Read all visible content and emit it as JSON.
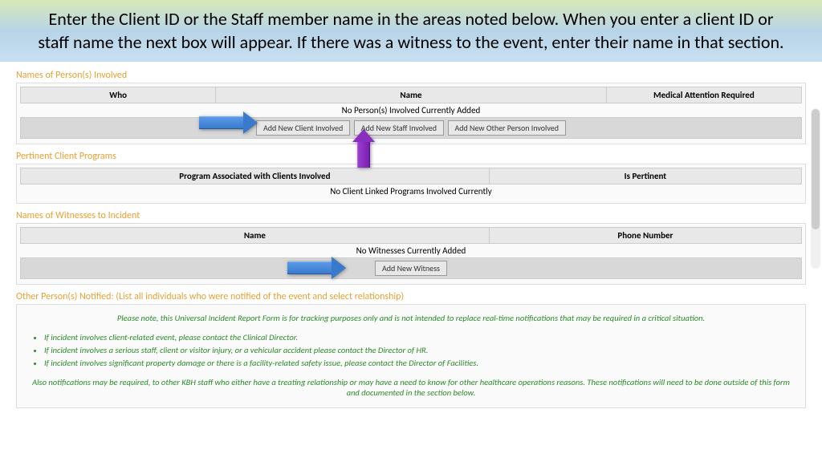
{
  "banner": {
    "text": "Enter the Client ID or the Staff member name in the areas noted below. When you enter a client ID or staff name the next box will appear. If there was a witness to the event, enter their name in that section."
  },
  "sections": {
    "persons": {
      "title": "Names of Person(s) Involved",
      "headers": [
        "Who",
        "Name",
        "Medical Attention Required"
      ],
      "empty": "No Person(s) Involved Currently Added",
      "buttons": {
        "client": "Add New Client Involved",
        "staff": "Add New Staff Involved",
        "other": "Add New Other Person Involved"
      }
    },
    "programs": {
      "title": "Pertinent Client Programs",
      "headers": [
        "Program Associated with Clients Involved",
        "Is Pertinent"
      ],
      "empty": "No Client Linked Programs Involved Currently"
    },
    "witnesses": {
      "title": "Names of Witnesses to Incident",
      "headers": [
        "Name",
        "Phone Number"
      ],
      "empty": "No Witnesses Currently Added",
      "buttons": {
        "add": "Add New Witness"
      }
    },
    "notified": {
      "title": "Other Person(s) Notified: (List all individuals who were notified of the event and select relationship)",
      "note": "Please note, this Universal Incident Report Form is for tracking purposes only and is not intended to replace real-time notifications that may be required in a critical situation.",
      "bullets": [
        "If incident involves client-related event, please contact the Clinical Director.",
        "If incident involves a serious staff, client or visitor injury, or a vehicular accident please contact the Director of HR.",
        "If incident involves significant property damage or there is a facility-related safety issue, please contact the Director of Facilities."
      ],
      "note2": "Also notifications may be required, to other KBH staff who either have a treating relationship or may have a need to know for other healthcare operations reasons. These notifications will need to be done outside of this form and documented in the section below."
    }
  }
}
